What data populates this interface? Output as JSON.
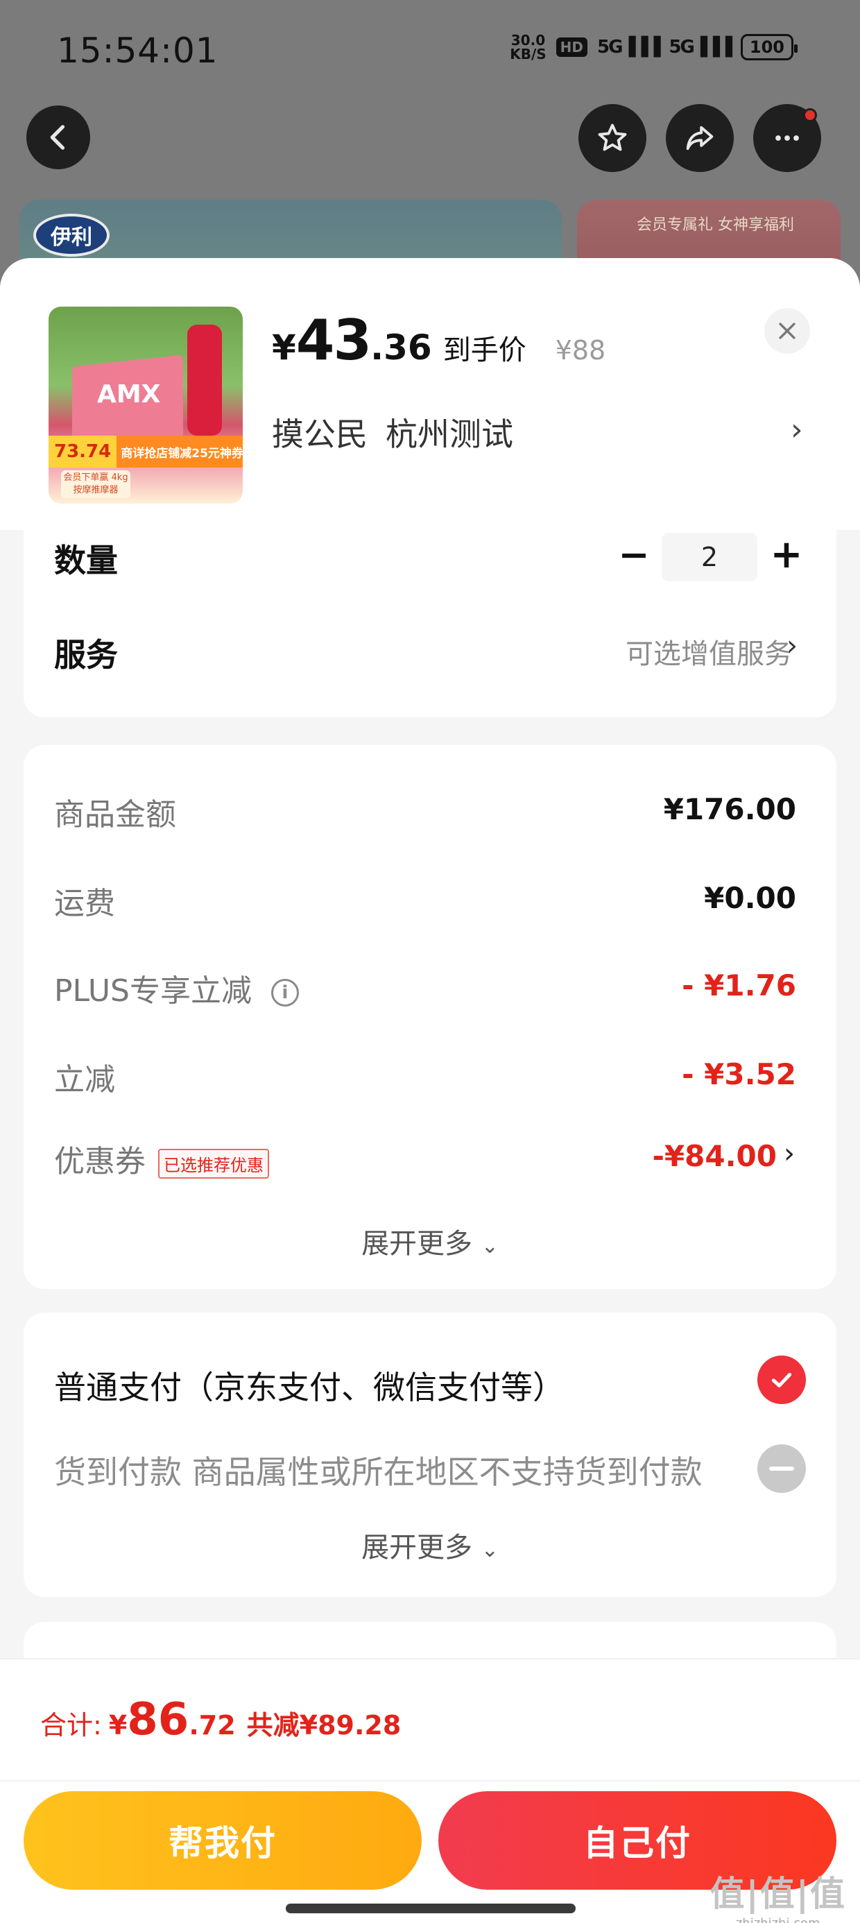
{
  "status_bar": {
    "time": "15:54:01",
    "net_speed_value": "30.0",
    "net_speed_unit": "KB/S",
    "hd": "HD",
    "signal1": "5G",
    "signal2": "5G",
    "battery": "100"
  },
  "background": {
    "brand_logo_text": "伊利",
    "right_banner_promo": "会员专属礼 女神享福利"
  },
  "product": {
    "image_box_label": "AMX",
    "image_promo_price": "73.74",
    "image_promo_text": "商详抢店铺减25元神券",
    "image_sub_text": "会员下单赢 4kg按摩推摩器",
    "price_symbol": "¥",
    "price_int": "43",
    "price_dec": ".36",
    "price_tag": "到手价",
    "original_price": "¥88",
    "address_name": "摸公民",
    "address_city": "杭州测试"
  },
  "quantity": {
    "label": "数量",
    "value": "2",
    "minus": "−",
    "plus": "+"
  },
  "service": {
    "label": "服务",
    "hint": "可选增值服务"
  },
  "amounts": {
    "goods_label": "商品金额",
    "goods_value": "¥176.00",
    "shipping_label": "运费",
    "shipping_value": "¥0.00",
    "plus_label": "PLUS专享立减",
    "plus_value": "- ¥1.76",
    "discount_label": "立减",
    "discount_value": "- ¥3.52",
    "coupon_label": "优惠券",
    "coupon_tag": "已选推荐优惠",
    "coupon_value": "-¥84.00",
    "expand_more": "展开更多"
  },
  "payment": {
    "normal_label": "普通支付（京东支付、微信支付等）",
    "cod_label": "货到付款 商品属性或所在地区不支持货到付款",
    "expand_more": "展开更多"
  },
  "footer": {
    "total_label": "合计:",
    "total_symbol": "¥",
    "total_int": "86",
    "total_dec": ".72",
    "total_saved": "共减¥89.28",
    "help_pay": "帮我付",
    "self_pay": "自己付"
  },
  "watermark": {
    "big": "值|值|值",
    "small": "zhizhizhi.com"
  },
  "colors": {
    "accent_red": "#e2231a",
    "pay_yellow": "#ffb414",
    "pay_red": "#f73a3a"
  }
}
